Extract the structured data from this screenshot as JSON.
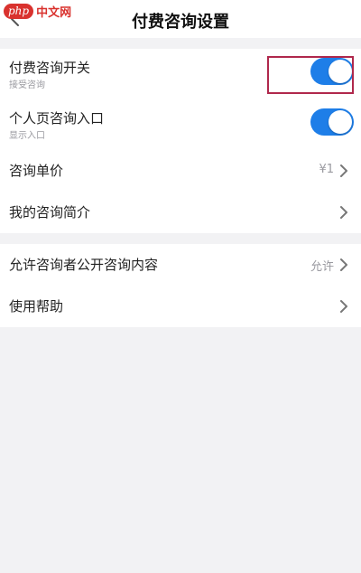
{
  "watermark": {
    "badge": "php",
    "text": "中文网"
  },
  "header": {
    "title": "付费咨询设置"
  },
  "settings": {
    "group1": [
      {
        "label": "付费咨询开关",
        "sub": "接受咨询",
        "toggle_on": true
      },
      {
        "label": "个人页咨询入口",
        "sub": "显示入口",
        "toggle_on": true
      },
      {
        "label": "咨询单价",
        "value": "¥1"
      },
      {
        "label": "我的咨询简介",
        "value": ""
      }
    ],
    "group2": [
      {
        "label": "允许咨询者公开咨询内容",
        "value": "允许"
      },
      {
        "label": "使用帮助",
        "value": ""
      }
    ]
  },
  "colors": {
    "accent": "#1e7ee8",
    "highlight": "#b0284c",
    "background": "#f2f2f4"
  }
}
